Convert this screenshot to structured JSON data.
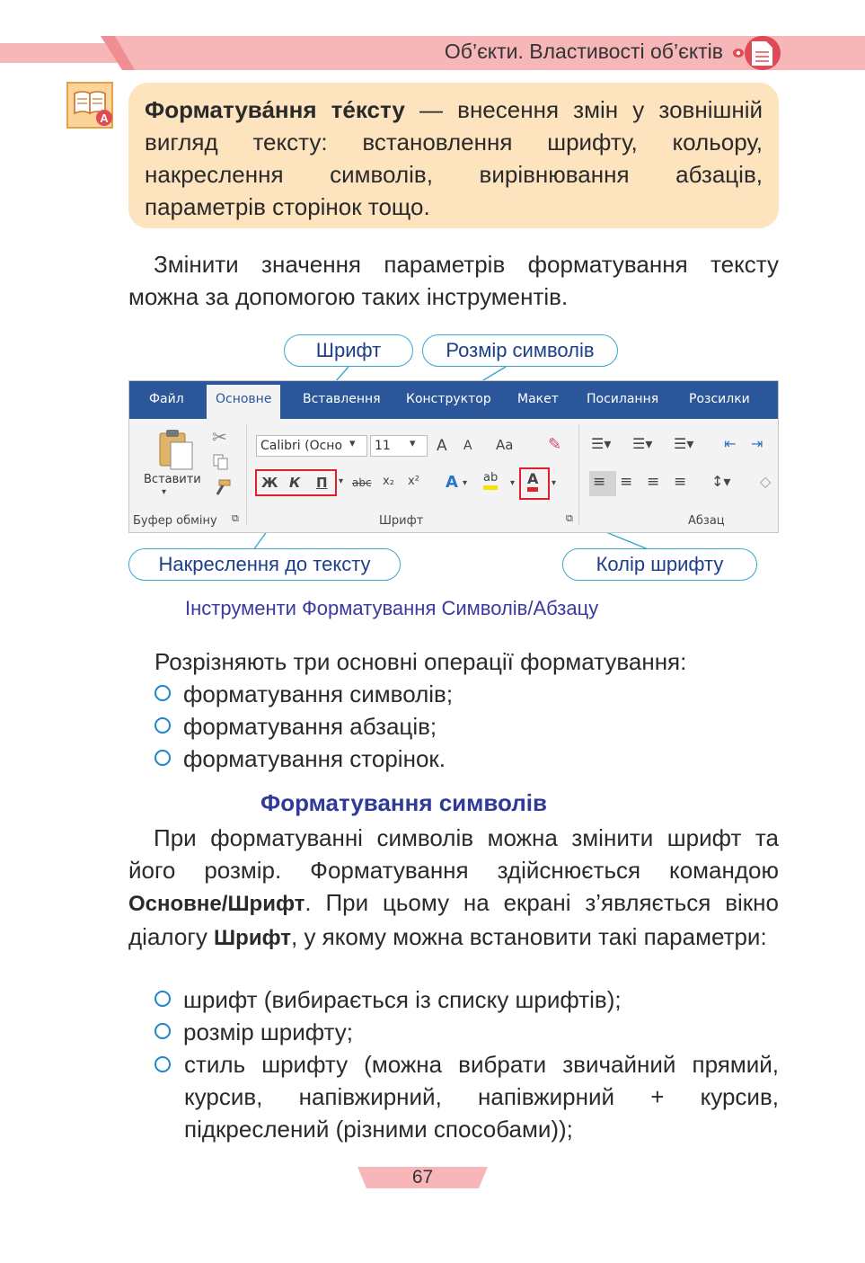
{
  "header": {
    "title": "Об’єкти. Властивості об’єктів"
  },
  "definition": {
    "term": "Форматува́ння те́ксту",
    "text": " — внесення змін у зовнішній вигляд тексту: встановлення шрифту, кольору, накреслення символів, вирівнювання абзаців, параметрів сторінок тощо."
  },
  "intro": {
    "text": "Змінити значення параметрів форматування тексту можна за допомогою таких інструментів."
  },
  "callouts": {
    "font": "Шрифт",
    "size": "Розмір символів",
    "style": "Накреслення до тексту",
    "color": "Колір шрифту"
  },
  "ribbon": {
    "tabs": [
      "Файл",
      "Основне",
      "Вставлення",
      "Конструктор",
      "Макет",
      "Посилання",
      "Розсилки"
    ],
    "active_tab": "Основне",
    "paste_label": "Вставити",
    "font_name": "Calibri (Осно",
    "font_size": "11",
    "group_clipboard": "Буфер обміну",
    "group_font": "Шрифт",
    "group_paragraph": "Абзац",
    "bold": "Ж",
    "italic": "К",
    "underline": "П",
    "strike": "abc",
    "subscript": "x₂",
    "superscript": "x²",
    "grow": "A",
    "shrink": "A",
    "case": "Aa",
    "font_color": "A",
    "highlight": "ab"
  },
  "caption": "Інструменти Форматування Символів/Абзацу",
  "operations": {
    "lead": "Розрізняють три основні операції форматування:",
    "items": [
      "форматування символів;",
      "форматування абзаців;",
      "форматування сторінок."
    ]
  },
  "section": {
    "title": "Форматування символів",
    "p1": "При форматуванні символів можна змінити шрифт та його розмір. Форматування здійснюється командою ",
    "cmd1": "Основне/Шрифт",
    "p2": ". При цьому на екрані з’являється вікно діалогу ",
    "cmd2": "Шрифт",
    "p3": ", у якому можна встановити такі параметри:",
    "items": [
      "шрифт (вибирається із списку шрифтів);",
      "розмір шрифту;",
      "стиль шрифту (можна вибрати звичайний прямий, курсив, напівжирний, напівжирний + курсив, підкреслений (різними способами));"
    ]
  },
  "page_number": "67",
  "colors": {
    "header_band": "#f5a7ab",
    "definition_bg": "#fde4bf",
    "accent_blue": "#35a7cf",
    "section_title": "#2f3a99",
    "ribbon_blue": "#2b579a"
  }
}
